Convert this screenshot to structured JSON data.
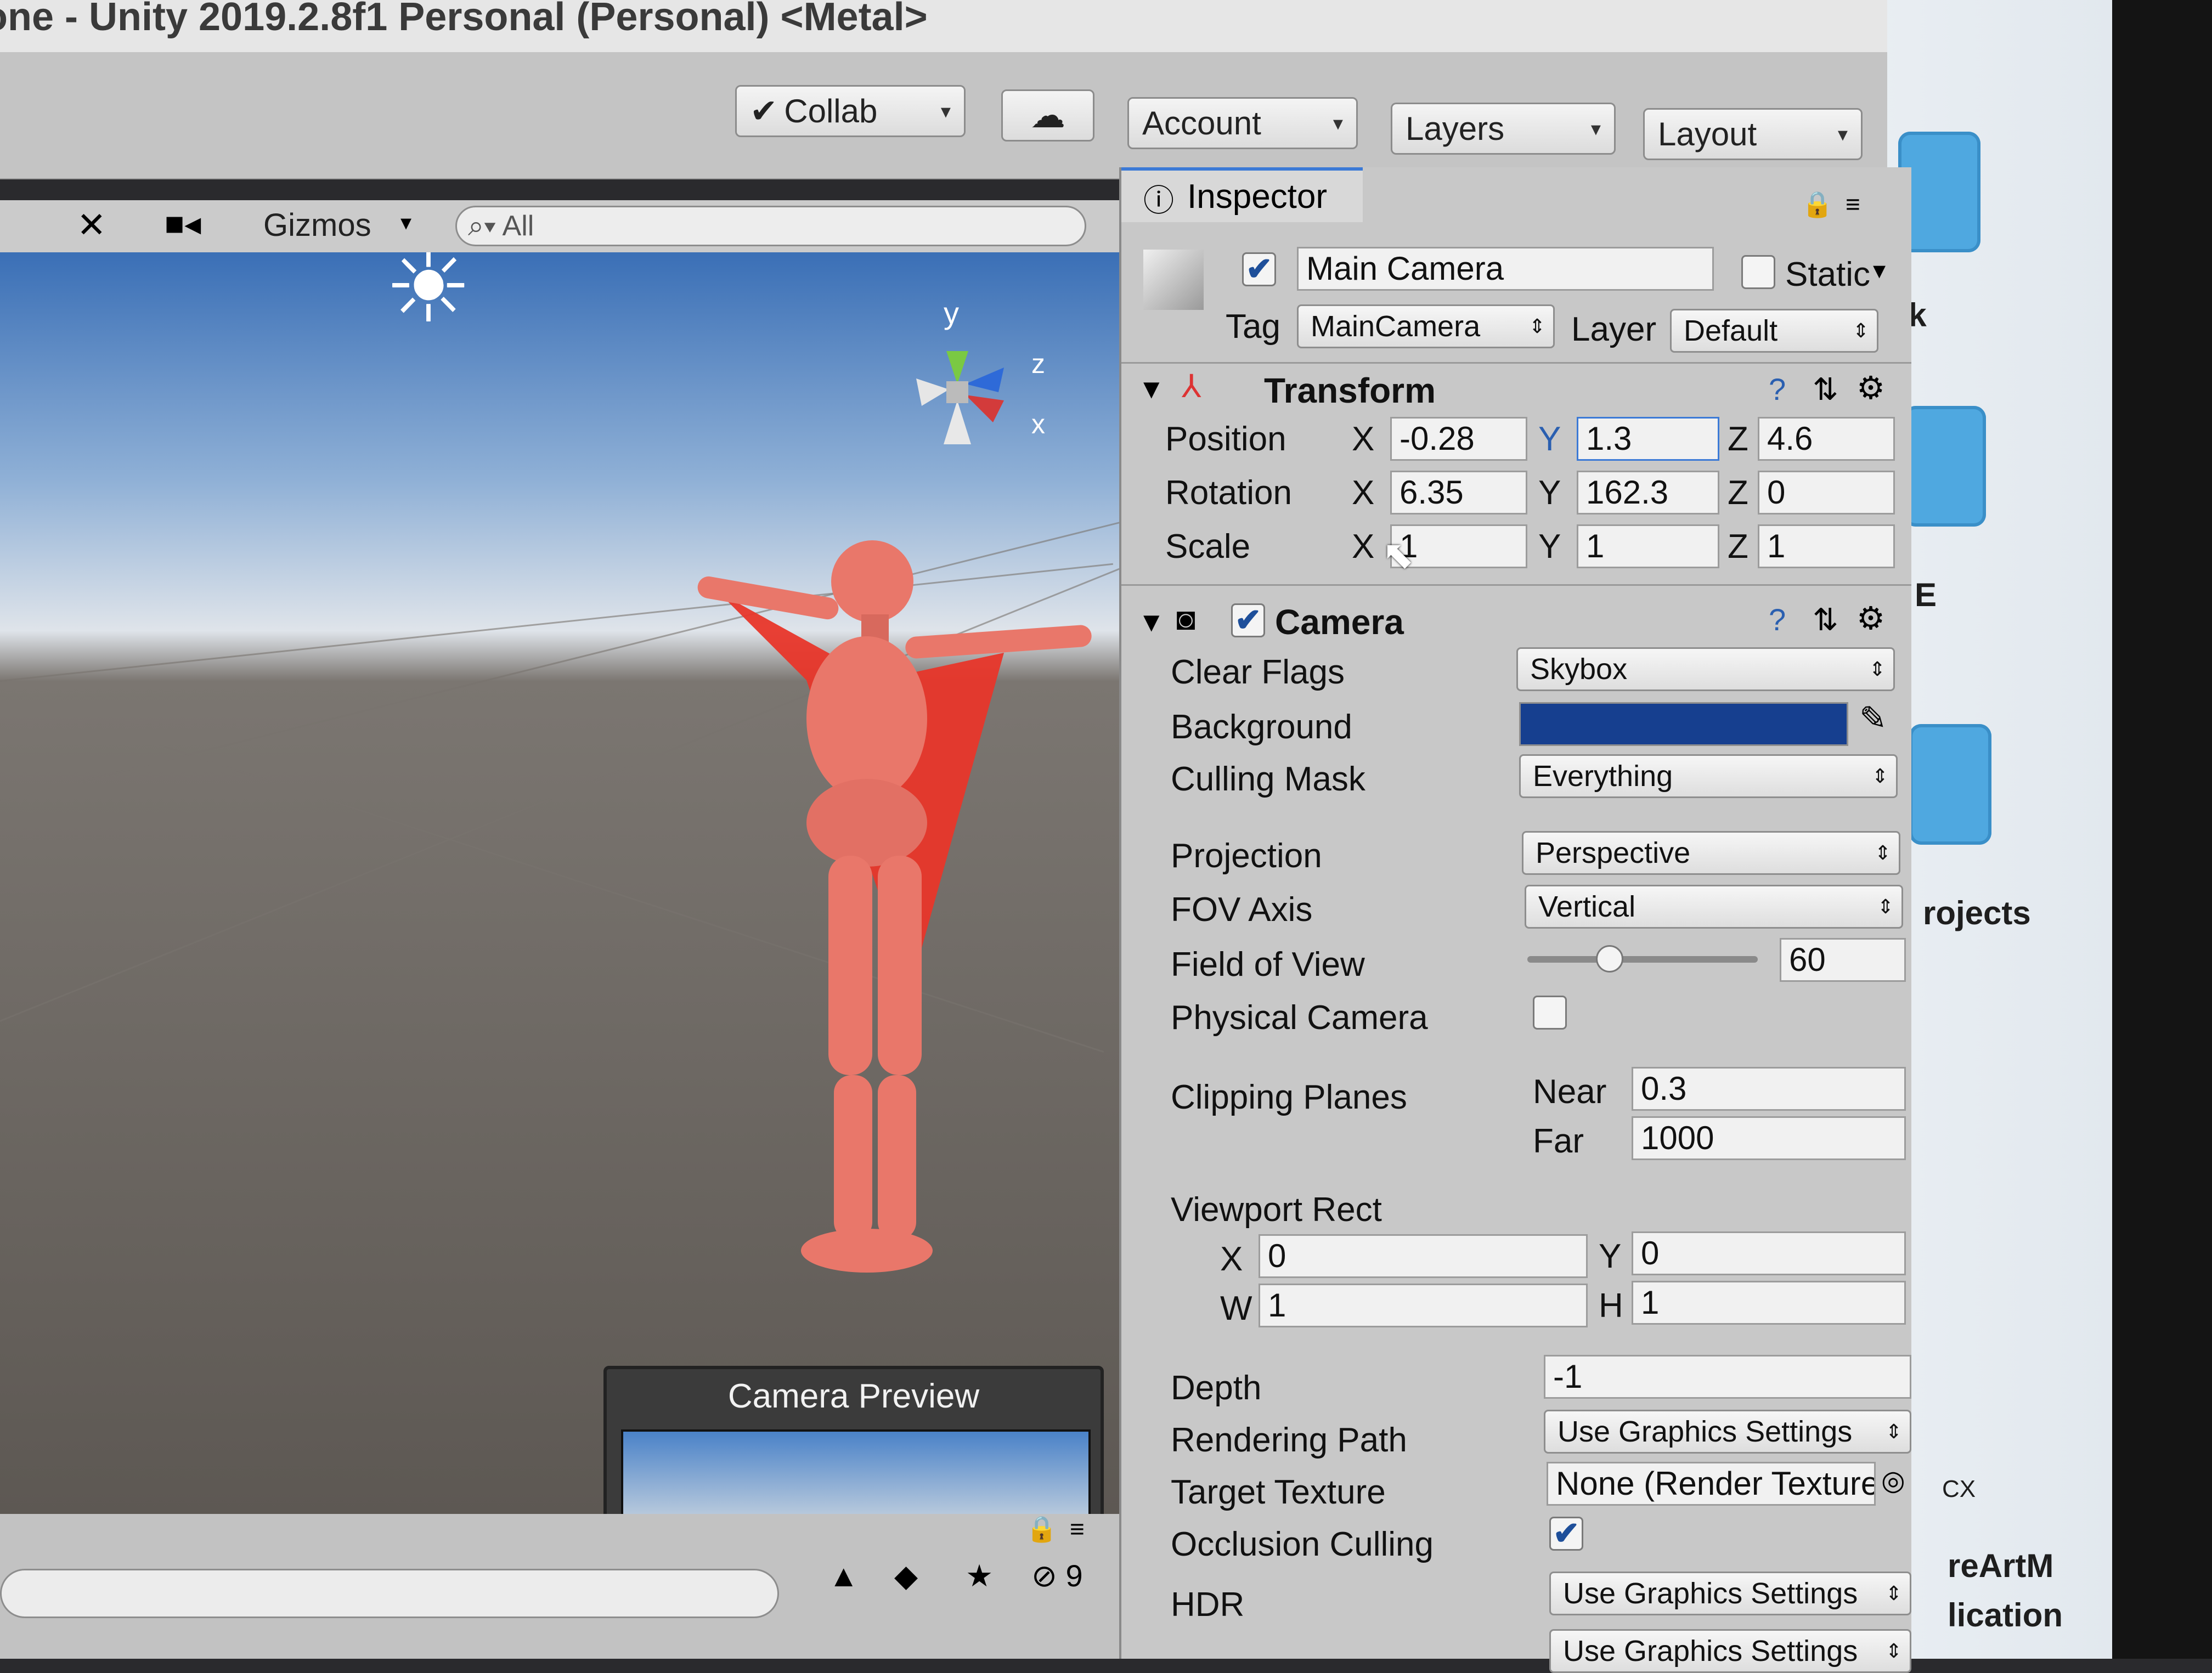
{
  "window": {
    "title": "one - Unity 2019.2.8f1 Personal (Personal) <Metal>"
  },
  "toolbar": {
    "collab": "Collab",
    "account": "Account",
    "layers": "Layers",
    "layout": "Layout"
  },
  "scene": {
    "gizmos": "Gizmos",
    "search_placeholder": "All",
    "gizmo_y": "y",
    "gizmo_z": "z",
    "gizmo_x": "x",
    "preview_title": "Camera Preview",
    "hidden_count": "9"
  },
  "inspector": {
    "tab": "Inspector",
    "object_name": "Main Camera",
    "static_label": "Static",
    "static_checked": false,
    "active_checked": true,
    "tag_label": "Tag",
    "tag_value": "MainCamera",
    "layer_label": "Layer",
    "layer_value": "Default",
    "transform": {
      "title": "Transform",
      "position_label": "Position",
      "rotation_label": "Rotation",
      "scale_label": "Scale",
      "axis_x": "X",
      "axis_y": "Y",
      "axis_z": "Z",
      "position": {
        "x": "-0.28",
        "y": "1.3",
        "z": "4.6"
      },
      "rotation": {
        "x": "6.35",
        "y": "162.3",
        "z": "0"
      },
      "scale": {
        "x": "1",
        "y": "1",
        "z": "1"
      }
    },
    "camera": {
      "title": "Camera",
      "enabled": true,
      "clear_flags_label": "Clear Flags",
      "clear_flags": "Skybox",
      "background_label": "Background",
      "background_color": "#163f8f",
      "culling_mask_label": "Culling Mask",
      "culling_mask": "Everything",
      "projection_label": "Projection",
      "projection": "Perspective",
      "fov_axis_label": "FOV Axis",
      "fov_axis": "Vertical",
      "fov_label": "Field of View",
      "fov": "60",
      "physical_camera_label": "Physical Camera",
      "physical_camera": false,
      "clipping_label": "Clipping Planes",
      "near_label": "Near",
      "near": "0.3",
      "far_label": "Far",
      "far": "1000",
      "viewport_label": "Viewport Rect",
      "vp_x_label": "X",
      "vp_x": "0",
      "vp_y_label": "Y",
      "vp_y": "0",
      "vp_w_label": "W",
      "vp_w": "1",
      "vp_h_label": "H",
      "vp_h": "1",
      "depth_label": "Depth",
      "depth": "-1",
      "rendering_path_label": "Rendering Path",
      "rendering_path": "Use Graphics Settings",
      "target_texture_label": "Target Texture",
      "target_texture": "None (Render Texture)",
      "occlusion_label": "Occlusion Culling",
      "occlusion": true,
      "hdr_label": "HDR",
      "hdr": "Use Graphics Settings",
      "msaa": "Use Graphics Settings"
    }
  },
  "desktop": {
    "text1": "rk",
    "text2": "E",
    "text3": "rojects",
    "text4": "CX",
    "text5": "reArtM",
    "text6": "lication"
  }
}
